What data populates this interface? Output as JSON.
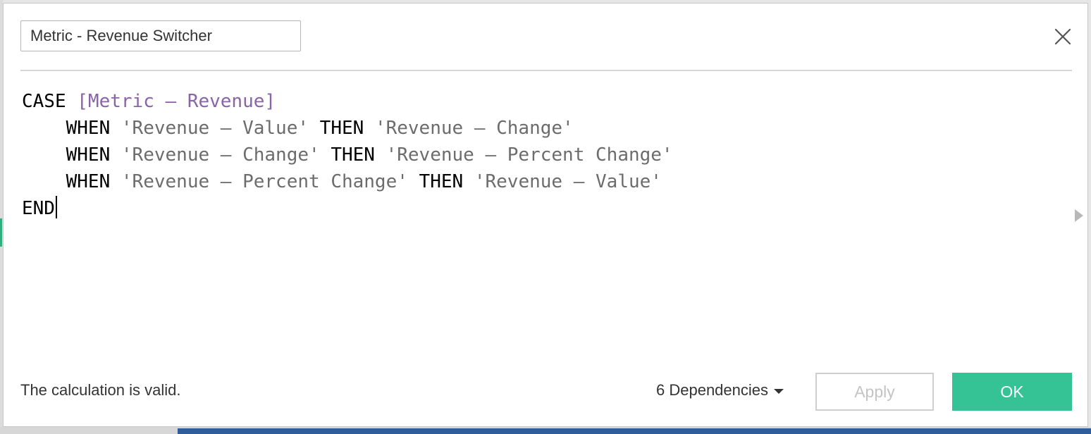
{
  "dialog": {
    "name_value": "Metric - Revenue Switcher",
    "close_icon": "close-icon"
  },
  "code": {
    "lines": [
      [
        {
          "type": "kw",
          "text": "CASE "
        },
        {
          "type": "field",
          "text": "[Metric – Revenue]"
        }
      ],
      [
        {
          "type": "plain",
          "text": "    "
        },
        {
          "type": "kw",
          "text": "WHEN "
        },
        {
          "type": "str",
          "text": "'Revenue – Value'"
        },
        {
          "type": "kw",
          "text": " THEN "
        },
        {
          "type": "str",
          "text": "'Revenue – Change'"
        }
      ],
      [
        {
          "type": "plain",
          "text": "    "
        },
        {
          "type": "kw",
          "text": "WHEN "
        },
        {
          "type": "str",
          "text": "'Revenue – Change'"
        },
        {
          "type": "kw",
          "text": " THEN "
        },
        {
          "type": "str",
          "text": "'Revenue – Percent Change'"
        }
      ],
      [
        {
          "type": "plain",
          "text": "    "
        },
        {
          "type": "kw",
          "text": "WHEN "
        },
        {
          "type": "str",
          "text": "'Revenue – Percent Change'"
        },
        {
          "type": "kw",
          "text": " THEN "
        },
        {
          "type": "str",
          "text": "'Revenue – Value'"
        }
      ],
      [
        {
          "type": "kw",
          "text": "END"
        }
      ]
    ]
  },
  "footer": {
    "status": "The calculation is valid.",
    "dependencies_label": "6 Dependencies",
    "apply_label": "Apply",
    "ok_label": "OK"
  },
  "colors": {
    "keyword": "#000000",
    "field": "#8a63a8",
    "string": "#6c6c6c",
    "ok_button": "#35c294",
    "apply_disabled_text": "#c4c4c4"
  }
}
